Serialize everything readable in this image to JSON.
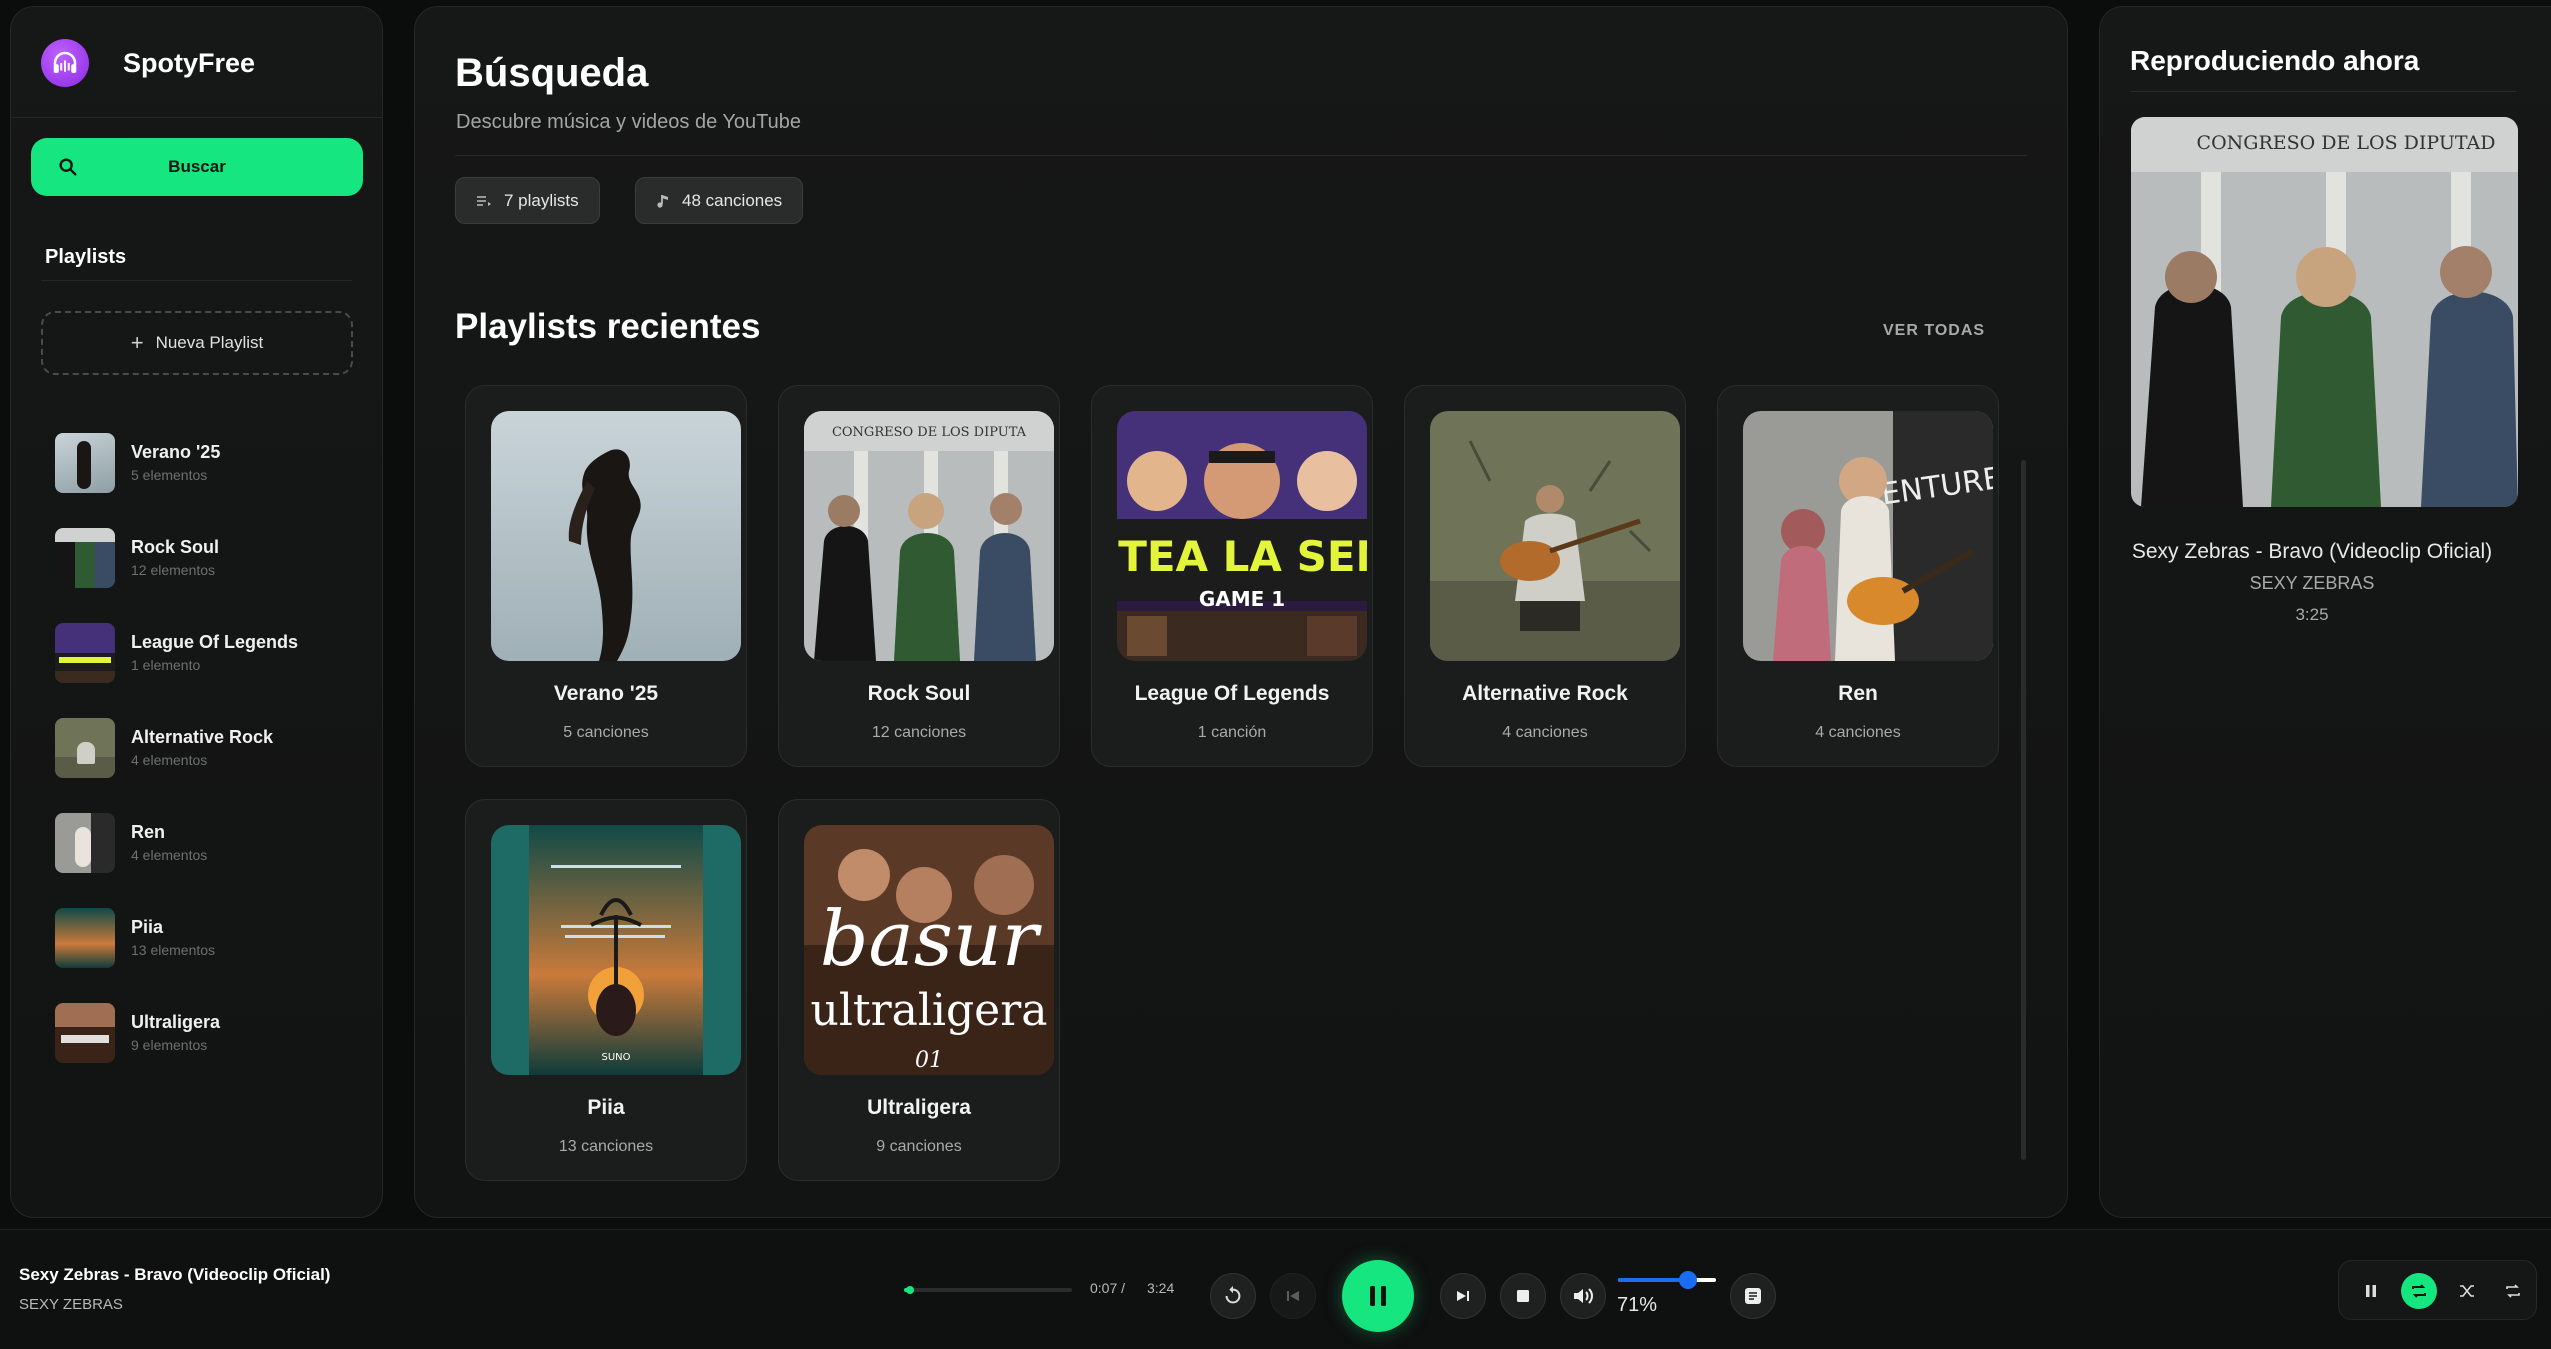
{
  "brand": {
    "name": "SpotyFree",
    "accent": "#16e67f",
    "logo_color": "#a64dff",
    "logo_icon": "headphones-icon"
  },
  "sidebar": {
    "search_label": "Buscar",
    "playlists_title": "Playlists",
    "new_playlist_label": "Nueva Playlist",
    "items": [
      {
        "name": "Verano '25",
        "count": "5 elementos",
        "thumb": "verano"
      },
      {
        "name": "Rock Soul",
        "count": "12 elementos",
        "thumb": "rock"
      },
      {
        "name": "League Of Legends",
        "count": "1 elemento",
        "thumb": "lol"
      },
      {
        "name": "Alternative Rock",
        "count": "4 elementos",
        "thumb": "alt"
      },
      {
        "name": "Ren",
        "count": "4 elementos",
        "thumb": "ren"
      },
      {
        "name": "Piia",
        "count": "13 elementos",
        "thumb": "piia"
      },
      {
        "name": "Ultraligera",
        "count": "9 elementos",
        "thumb": "ultra"
      }
    ]
  },
  "main": {
    "title": "Búsqueda",
    "subtitle": "Descubre música y videos de YouTube",
    "chips": {
      "playlists": "7 playlists",
      "songs": "48 canciones"
    },
    "recent_title": "Playlists recientes",
    "see_all": "VER TODAS",
    "cards": [
      {
        "name": "Verano '25",
        "count": "5 canciones",
        "art": "verano",
        "art_text": ""
      },
      {
        "name": "Rock Soul",
        "count": "12 canciones",
        "art": "rock",
        "art_text": "CONGRESO DE LOS DIPUTA"
      },
      {
        "name": "League Of Legends",
        "count": "1 canción",
        "art": "lol",
        "art_text": "ASTEA LA SEMII",
        "art_text2": "GAME 1"
      },
      {
        "name": "Alternative Rock",
        "count": "4 canciones",
        "art": "alt",
        "art_text": ""
      },
      {
        "name": "Ren",
        "count": "4 canciones",
        "art": "ren",
        "art_text": "ENTURE"
      },
      {
        "name": "Piia",
        "count": "13 canciones",
        "art": "piia",
        "art_text": "SUNO"
      },
      {
        "name": "Ultraligera",
        "count": "9 canciones",
        "art": "ultra",
        "art_text": "basur",
        "art_text2": "ultraligera",
        "art_text3": "01"
      }
    ]
  },
  "now_playing": {
    "title": "Reproduciendo ahora",
    "art_text": "CONGRESO DE LOS DIPUTAD",
    "song": "Sexy Zebras - Bravo (Videoclip Oficial)",
    "artist": "SEXY ZEBRAS",
    "duration": "3:25"
  },
  "player": {
    "song": "Sexy Zebras - Bravo (Videoclip Oficial)",
    "artist": "SEXY ZEBRAS",
    "current_time": "0:07 /",
    "total_time": "3:24",
    "progress": 0.034,
    "volume": 0.71,
    "volume_label": "71%",
    "volume_color": "#1a6cf0"
  }
}
